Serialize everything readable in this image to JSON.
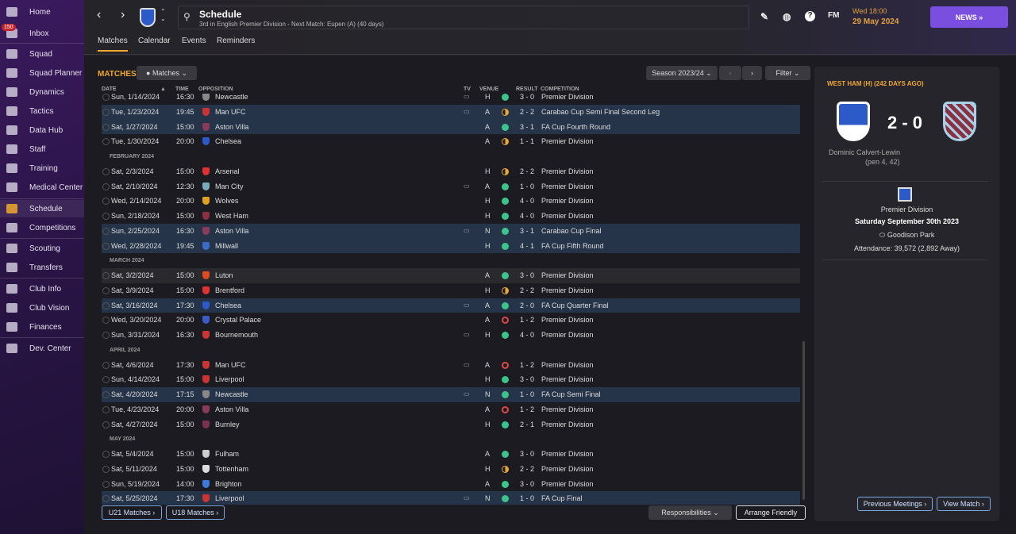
{
  "sidebar": {
    "inbox_badge": "150",
    "items": [
      {
        "label": "Home",
        "icon": "home-icon"
      },
      {
        "label": "Inbox",
        "icon": "inbox-icon"
      },
      {
        "label": "Squad",
        "icon": "shirt-icon"
      },
      {
        "label": "Squad Planner",
        "icon": "clipboard-icon"
      },
      {
        "label": "Dynamics",
        "icon": "dynamics-icon"
      },
      {
        "label": "Tactics",
        "icon": "tactics-icon"
      },
      {
        "label": "Data Hub",
        "icon": "data-hub-icon"
      },
      {
        "label": "Staff",
        "icon": "staff-icon"
      },
      {
        "label": "Training",
        "icon": "training-icon"
      },
      {
        "label": "Medical Center",
        "icon": "medical-icon"
      },
      {
        "label": "Schedule",
        "icon": "calendar-icon",
        "active": true
      },
      {
        "label": "Competitions",
        "icon": "trophy-icon"
      },
      {
        "label": "Scouting",
        "icon": "scouting-icon"
      },
      {
        "label": "Transfers",
        "icon": "transfers-icon"
      },
      {
        "label": "Club Info",
        "icon": "shield-icon"
      },
      {
        "label": "Club Vision",
        "icon": "vision-icon"
      },
      {
        "label": "Finances",
        "icon": "finances-icon"
      },
      {
        "label": "Dev. Center",
        "icon": "dev-center-icon"
      }
    ]
  },
  "header": {
    "title": "Schedule",
    "subtitle": "3rd in English Premier Division - Next Match: Eupen (A) (40 days)",
    "fm_label": "FM",
    "date_line1": "Wed 18:00",
    "date_line2": "29 May 2024",
    "news_label": "NEWS »"
  },
  "tabs": [
    "Matches",
    "Calendar",
    "Events",
    "Reminders"
  ],
  "main": {
    "title": "MATCHES",
    "view_label": "Matches",
    "season_label": "Season 2023/24",
    "filter_label": "Filter",
    "columns": {
      "date": "DATE",
      "time": "TIME",
      "opposition": "OPPOSITION",
      "tv": "TV",
      "venue": "VENUE",
      "result": "RESULT",
      "competition": "COMPETITION"
    },
    "rows": [
      {
        "date": "Sun, 1/14/2024",
        "time": "16:30",
        "opp": "Newcastle",
        "tv": true,
        "venue": "H",
        "outcome": "W",
        "result": "3 - 0",
        "comp": "Premier Division",
        "crest": "#888"
      },
      {
        "date": "Tue, 1/23/2024",
        "time": "19:45",
        "opp": "Man UFC",
        "tv": true,
        "venue": "A",
        "outcome": "D",
        "result": "2 - 2",
        "comp": "Carabao Cup Semi Final Second Leg",
        "hl": true,
        "crest": "#c33"
      },
      {
        "date": "Sat, 1/27/2024",
        "time": "15:00",
        "opp": "Aston Villa",
        "venue": "A",
        "outcome": "W",
        "result": "3 - 1",
        "comp": "FA Cup Fourth Round",
        "hl": true,
        "crest": "#8a3a5a"
      },
      {
        "date": "Tue, 1/30/2024",
        "time": "20:00",
        "opp": "Chelsea",
        "venue": "A",
        "outcome": "D",
        "result": "1 - 1",
        "comp": "Premier Division",
        "crest": "#2c5ac8"
      },
      {
        "month": "FEBRUARY 2024"
      },
      {
        "date": "Sat, 2/3/2024",
        "time": "15:00",
        "opp": "Arsenal",
        "venue": "H",
        "outcome": "D",
        "result": "2 - 2",
        "comp": "Premier Division",
        "crest": "#d33"
      },
      {
        "date": "Sat, 2/10/2024",
        "time": "12:30",
        "opp": "Man City",
        "tv": true,
        "venue": "A",
        "outcome": "W",
        "result": "1 - 0",
        "comp": "Premier Division",
        "crest": "#7ab"
      },
      {
        "date": "Wed, 2/14/2024",
        "time": "20:00",
        "opp": "Wolves",
        "venue": "H",
        "outcome": "W",
        "result": "4 - 0",
        "comp": "Premier Division",
        "crest": "#e0a020"
      },
      {
        "date": "Sun, 2/18/2024",
        "time": "15:00",
        "opp": "West Ham",
        "venue": "H",
        "outcome": "W",
        "result": "4 - 0",
        "comp": "Premier Division",
        "crest": "#8a3040"
      },
      {
        "date": "Sun, 2/25/2024",
        "time": "16:30",
        "opp": "Aston Villa",
        "tv": true,
        "venue": "N",
        "outcome": "W",
        "result": "3 - 1",
        "comp": "Carabao Cup Final",
        "hl": true,
        "crest": "#8a3a5a"
      },
      {
        "date": "Wed, 2/28/2024",
        "time": "19:45",
        "opp": "Millwall",
        "venue": "H",
        "outcome": "W",
        "result": "4 - 1",
        "comp": "FA Cup Fifth Round",
        "hl": true,
        "crest": "#3a6ac8"
      },
      {
        "month": "MARCH 2024"
      },
      {
        "date": "Sat, 3/2/2024",
        "time": "15:00",
        "opp": "Luton",
        "venue": "A",
        "outcome": "W",
        "result": "3 - 0",
        "comp": "Premier Division",
        "alt": true,
        "crest": "#e04a20"
      },
      {
        "date": "Sat, 3/9/2024",
        "time": "15:00",
        "opp": "Brentford",
        "venue": "H",
        "outcome": "D",
        "result": "2 - 2",
        "comp": "Premier Division",
        "crest": "#d33"
      },
      {
        "date": "Sat, 3/16/2024",
        "time": "17:30",
        "opp": "Chelsea",
        "tv": true,
        "venue": "A",
        "outcome": "W",
        "result": "2 - 0",
        "comp": "FA Cup Quarter Final",
        "hl": true,
        "crest": "#2c5ac8"
      },
      {
        "date": "Wed, 3/20/2024",
        "time": "20:00",
        "opp": "Crystal Palace",
        "venue": "A",
        "outcome": "L",
        "result": "1 - 2",
        "comp": "Premier Division",
        "crest": "#3a5ac8"
      },
      {
        "date": "Sun, 3/31/2024",
        "time": "16:30",
        "opp": "Bournemouth",
        "tv": true,
        "venue": "H",
        "outcome": "W",
        "result": "4 - 0",
        "comp": "Premier Division",
        "crest": "#c33"
      },
      {
        "month": "APRIL 2024"
      },
      {
        "date": "Sat, 4/6/2024",
        "time": "17:30",
        "opp": "Man UFC",
        "tv": true,
        "venue": "A",
        "outcome": "L",
        "result": "1 - 2",
        "comp": "Premier Division",
        "crest": "#c33"
      },
      {
        "date": "Sun, 4/14/2024",
        "time": "15:00",
        "opp": "Liverpool",
        "venue": "H",
        "outcome": "W",
        "result": "3 - 0",
        "comp": "Premier Division",
        "crest": "#c33"
      },
      {
        "date": "Sat, 4/20/2024",
        "time": "17:15",
        "opp": "Newcastle",
        "tv": true,
        "venue": "N",
        "outcome": "W",
        "result": "1 - 0",
        "comp": "FA Cup Semi Final",
        "hl": true,
        "crest": "#888"
      },
      {
        "date": "Tue, 4/23/2024",
        "time": "20:00",
        "opp": "Aston Villa",
        "venue": "A",
        "outcome": "L",
        "result": "1 - 2",
        "comp": "Premier Division",
        "crest": "#8a3a5a"
      },
      {
        "date": "Sat, 4/27/2024",
        "time": "15:00",
        "opp": "Burnley",
        "venue": "H",
        "outcome": "W",
        "result": "2 - 1",
        "comp": "Premier Division",
        "crest": "#7a3050"
      },
      {
        "month": "MAY 2024"
      },
      {
        "date": "Sat, 5/4/2024",
        "time": "15:00",
        "opp": "Fulham",
        "venue": "A",
        "outcome": "W",
        "result": "3 - 0",
        "comp": "Premier Division",
        "crest": "#ccc"
      },
      {
        "date": "Sat, 5/11/2024",
        "time": "15:00",
        "opp": "Tottenham",
        "venue": "H",
        "outcome": "D",
        "result": "2 - 2",
        "comp": "Premier Division",
        "crest": "#ddd"
      },
      {
        "date": "Sun, 5/19/2024",
        "time": "14:00",
        "opp": "Brighton",
        "venue": "A",
        "outcome": "W",
        "result": "3 - 0",
        "comp": "Premier Division",
        "crest": "#3a7ad8"
      },
      {
        "date": "Sat, 5/25/2024",
        "time": "17:30",
        "opp": "Liverpool",
        "tv": true,
        "venue": "N",
        "outcome": "W",
        "result": "1 - 0",
        "comp": "FA Cup Final",
        "hl": true,
        "crest": "#c33"
      }
    ],
    "u21_label": "U21 Matches ›",
    "u18_label": "U18 Matches ›",
    "responsibilities_label": "Responsibilities",
    "arrange_label": "Arrange Friendly"
  },
  "panel": {
    "heading": "WEST HAM (H) (242 DAYS AGO)",
    "score": "2 - 0",
    "scorer": "Dominic Calvert-Lewin",
    "scorer_detail": "(pen 4, 42)",
    "competition": "Premier Division",
    "match_date": "Saturday September 30th 2023",
    "stadium": "Goodison Park",
    "attendance": "Attendance: 39,572 (2,892 Away)",
    "prev_label": "Previous Meetings ›",
    "view_label": "View Match ›"
  },
  "colors": {
    "accent": "#f0a830",
    "news": "#7a4fe0",
    "win": "#3cc48a",
    "draw": "#e8a838",
    "loss": "#e04848"
  }
}
